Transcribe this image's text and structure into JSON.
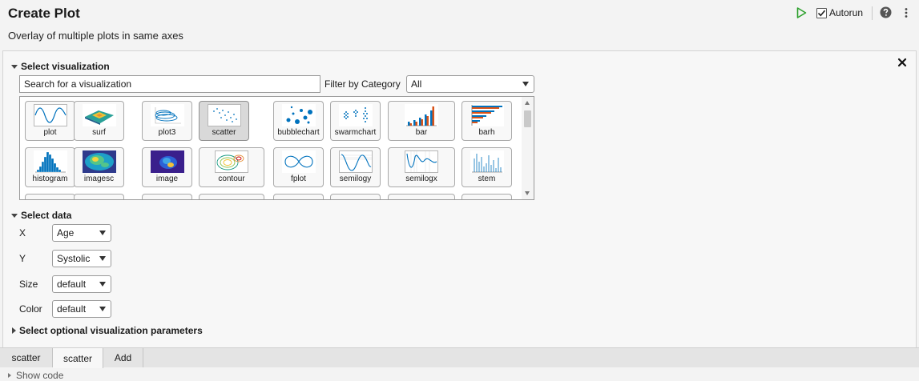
{
  "header": {
    "title": "Create Plot",
    "subtitle": "Overlay of multiple plots in same axes",
    "autorun_label": "Autorun",
    "autorun_checked": true,
    "run_icon": "play-icon",
    "help_icon": "help-icon",
    "menu_icon": "kebab-icon",
    "run_color": "#2ca02c"
  },
  "select_visualization": {
    "heading": "Select visualization",
    "search_value": "Search for a visualization",
    "filter_label": "Filter by Category",
    "category_value": "All",
    "selected": "scatter",
    "gallery": [
      {
        "label": "plot"
      },
      {
        "label": "surf"
      },
      {
        "label": "plot3"
      },
      {
        "label": "scatter"
      },
      {
        "label": "bubblechart"
      },
      {
        "label": "swarmchart"
      },
      {
        "label": "bar"
      },
      {
        "label": "barh"
      },
      {
        "label": "histogram"
      },
      {
        "label": "imagesc"
      },
      {
        "label": "image"
      },
      {
        "label": "contour"
      },
      {
        "label": "fplot"
      },
      {
        "label": "semilogy"
      },
      {
        "label": "semilogx"
      },
      {
        "label": "stem"
      }
    ]
  },
  "select_data": {
    "heading": "Select data",
    "fields": [
      {
        "label": "X",
        "value": "Age"
      },
      {
        "label": "Y",
        "value": "Systolic"
      },
      {
        "label": "Size",
        "value": "default"
      },
      {
        "label": "Color",
        "value": "default"
      }
    ]
  },
  "optional_params": {
    "heading": "Select optional visualization parameters"
  },
  "tabs": [
    {
      "label": "scatter",
      "active": false
    },
    {
      "label": "scatter",
      "active": true
    },
    {
      "label": "Add",
      "active": false
    }
  ],
  "footer": {
    "show_code": "Show code"
  }
}
